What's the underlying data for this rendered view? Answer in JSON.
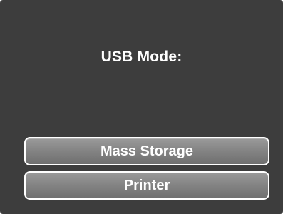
{
  "screen": {
    "title": "USB Mode:"
  },
  "menu": {
    "items": [
      {
        "label": "Mass Storage"
      },
      {
        "label": "Printer"
      }
    ]
  },
  "colors": {
    "background": "#3d3d3d",
    "button_fill": "#858585",
    "button_border": "#ffffff",
    "text": "#ffffff"
  }
}
